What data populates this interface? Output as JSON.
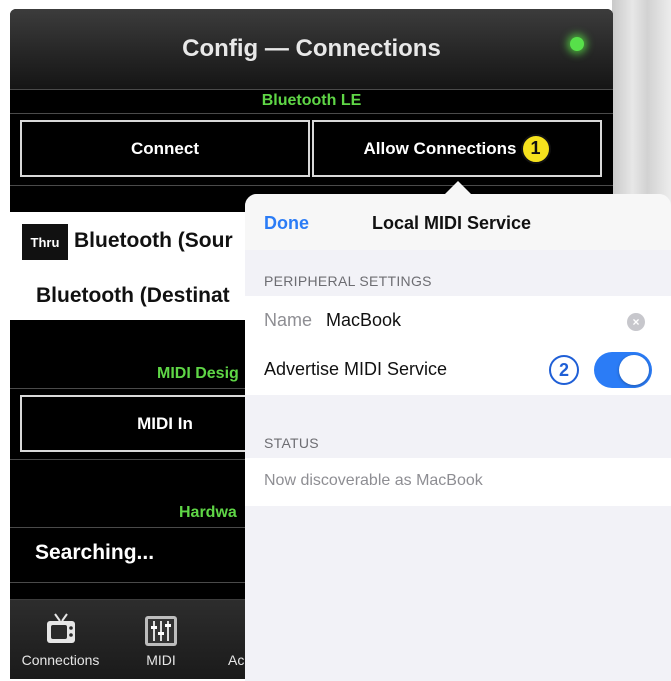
{
  "app": {
    "title": "Config — Connections",
    "status_led_color": "#57e04a"
  },
  "bluetooth": {
    "section_label": "Bluetooth LE",
    "connect_label": "Connect",
    "allow_label": "Allow Connections",
    "allow_marker": "1"
  },
  "list": {
    "thru_badge": "Thru",
    "source_item": "Bluetooth (Sour",
    "destination_item": "Bluetooth (Destinat"
  },
  "midi_design": {
    "section_label": "MIDI Desig",
    "midi_in_label": "MIDI In"
  },
  "hardware": {
    "section_label": "Hardwa",
    "status": "Searching..."
  },
  "tabbar": {
    "tabs": [
      {
        "label": "Connections",
        "icon": "tv-icon"
      },
      {
        "label": "MIDI",
        "icon": "mixer-sliders-icon"
      },
      {
        "label": "Ac",
        "icon": "partial-icon"
      }
    ]
  },
  "popover": {
    "done_label": "Done",
    "title": "Local MIDI Service",
    "peripheral_header": "PERIPHERAL SETTINGS",
    "name_label": "Name",
    "name_value": "MacBook",
    "advertise_label": "Advertise MIDI Service",
    "advertise_marker": "2",
    "advertise_on": true,
    "status_header": "STATUS",
    "status_text": "Now discoverable as MacBook"
  },
  "colors": {
    "accent_green": "#5fd646",
    "ios_blue": "#2b7cf6",
    "marker_yellow": "#f6e21d"
  }
}
